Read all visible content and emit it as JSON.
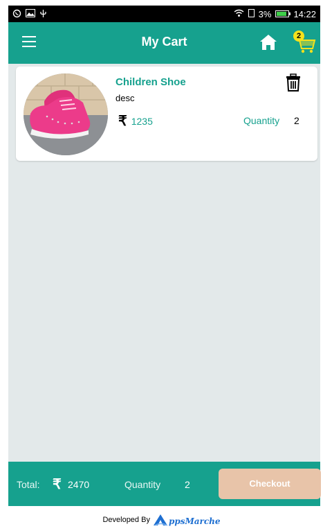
{
  "status_bar": {
    "battery_percent": "3%",
    "time": "14:22"
  },
  "app_bar": {
    "title": "My Cart",
    "cart_badge_count": "2"
  },
  "cart": {
    "items": [
      {
        "name": "Children Shoe",
        "description": "desc",
        "currency_symbol": "₹",
        "price": "1235",
        "quantity_label": "Quantity",
        "quantity": "2"
      }
    ]
  },
  "bottom_bar": {
    "total_label": "Total:",
    "currency_symbol": "₹",
    "total_value": "2470",
    "quantity_label": "Quantity",
    "quantity_value": "2",
    "checkout_label": "Checkout"
  },
  "footer": {
    "developed_by_label": "Developed By",
    "brand_name": "ppsMarche"
  },
  "colors": {
    "primary": "#16a18e",
    "content_bg": "#e3e9ea",
    "checkout_btn": "#e8c4a9",
    "badge": "#f5e11c",
    "brand_blue": "#1e6fd1"
  }
}
